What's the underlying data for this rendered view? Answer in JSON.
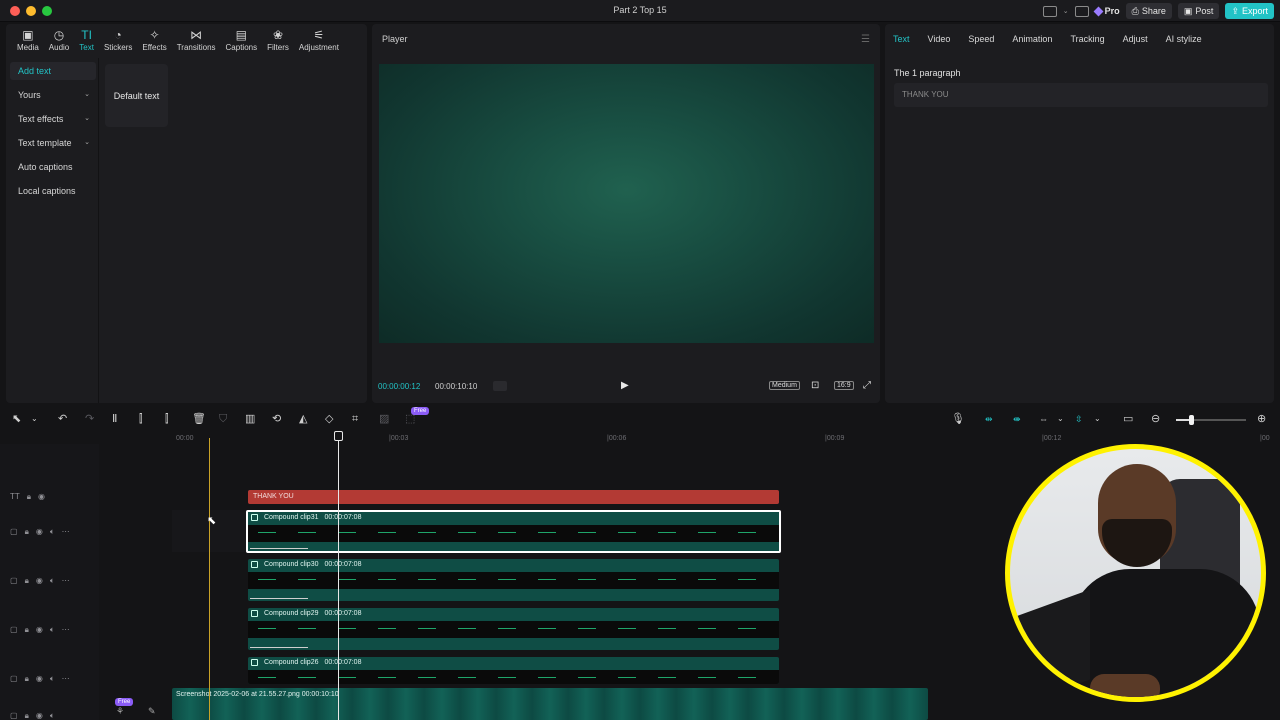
{
  "window": {
    "title": "Part 2 Top 15"
  },
  "header": {
    "pro_label": "Pro",
    "share_label": "Share",
    "post_label": "Post",
    "export_label": "Export"
  },
  "colors": {
    "accent": "#22c3c6",
    "text_clip": "#b33a34",
    "compound_clip": "#0f4d45",
    "cam_ring": "#fff200"
  },
  "media_tabs": [
    {
      "label": "Media",
      "icon": "media-icon"
    },
    {
      "label": "Audio",
      "icon": "audio-icon"
    },
    {
      "label": "Text",
      "icon": "text-icon",
      "active": true
    },
    {
      "label": "Stickers",
      "icon": "sticker-icon"
    },
    {
      "label": "Effects",
      "icon": "effects-icon"
    },
    {
      "label": "Transitions",
      "icon": "transitions-icon"
    },
    {
      "label": "Captions",
      "icon": "captions-icon"
    },
    {
      "label": "Filters",
      "icon": "filters-icon"
    },
    {
      "label": "Adjustment",
      "icon": "adjustment-icon"
    }
  ],
  "side_menu": [
    {
      "label": "Add text",
      "active": true
    },
    {
      "label": "Yours",
      "dropdown": true
    },
    {
      "label": "Text effects",
      "dropdown": true
    },
    {
      "label": "Text template",
      "dropdown": true
    },
    {
      "label": "Auto captions"
    },
    {
      "label": "Local captions"
    }
  ],
  "default_text_card": "Default text",
  "player": {
    "title": "Player",
    "current_time": "00:00:00:12",
    "total_time": "00:00:10:10",
    "quality": "Medium",
    "ratio": "16:9"
  },
  "inspector": {
    "tabs": [
      "Text",
      "Video",
      "Speed",
      "Animation",
      "Tracking",
      "Adjust",
      "AI stylize"
    ],
    "paragraph_label": "The 1 paragraph",
    "paragraph_value": "THANK YOU"
  },
  "timeline": {
    "free_badge": "Free",
    "ruler": [
      "00:00",
      "|00:03",
      "|00:06",
      "|00:09",
      "|00:12",
      "|00"
    ],
    "text_clip": "THANK YOU",
    "compound_clips": [
      {
        "name": "Compound clip31",
        "duration": "00:00:07:08",
        "selected": true
      },
      {
        "name": "Compound clip30",
        "duration": "00:00:07:08"
      },
      {
        "name": "Compound clip29",
        "duration": "00:00:07:08"
      },
      {
        "name": "Compound clip26",
        "duration": "00:00:07:08"
      }
    ],
    "screenshot_clip": "Screenshot 2025-02-06 at 21.55.27.png   00:00:10:10"
  }
}
